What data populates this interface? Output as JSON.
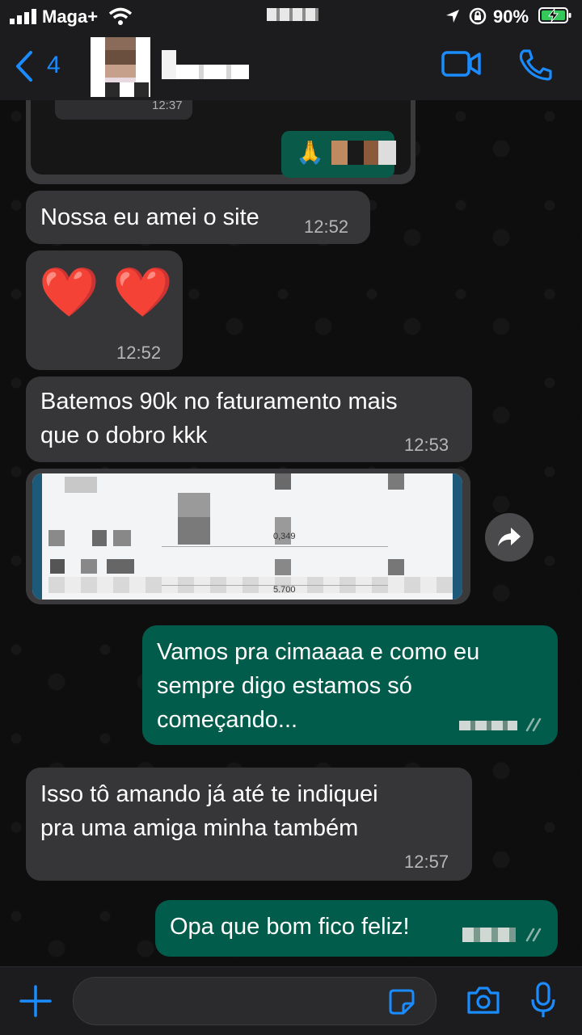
{
  "status_bar": {
    "carrier": "Maga+",
    "battery": "90%"
  },
  "nav": {
    "back_count": "4"
  },
  "messages": [
    {
      "dir": "in",
      "time": "12:37"
    },
    {
      "dir": "in",
      "text": "Nossa eu amei o site",
      "time": "12:52"
    },
    {
      "dir": "in",
      "text": "❤️ ❤️",
      "time": "12:52"
    },
    {
      "dir": "in",
      "text": "Batemos 90k no faturamento mais\nque o dobro kkk",
      "time": "12:53"
    },
    {
      "dir": "in",
      "image_labels": [
        "0,349",
        "5.700"
      ]
    },
    {
      "dir": "out",
      "text": "Vamos pra cimaaaa e como eu\nsempre digo estamos só\ncomeçando..."
    },
    {
      "dir": "in",
      "text": "Isso tô amando já até te indiquei\npra uma amiga minha também",
      "time": "12:57"
    },
    {
      "dir": "out",
      "text": "Opa que bom fico feliz!"
    }
  ],
  "colors": {
    "accent": "#1a8cff",
    "incoming": "#363638",
    "outgoing": "#015c4b",
    "bar": "#1c1c1e"
  },
  "icons": {
    "signal": "signal-icon",
    "wifi": "wifi-icon",
    "location": "location-icon",
    "battery": "battery-icon",
    "back": "chevron-left-icon",
    "video": "video-icon",
    "phone": "phone-icon",
    "forward": "forward-icon",
    "plus": "plus-icon",
    "sticker": "sticker-icon",
    "camera": "camera-icon",
    "mic": "mic-icon"
  }
}
